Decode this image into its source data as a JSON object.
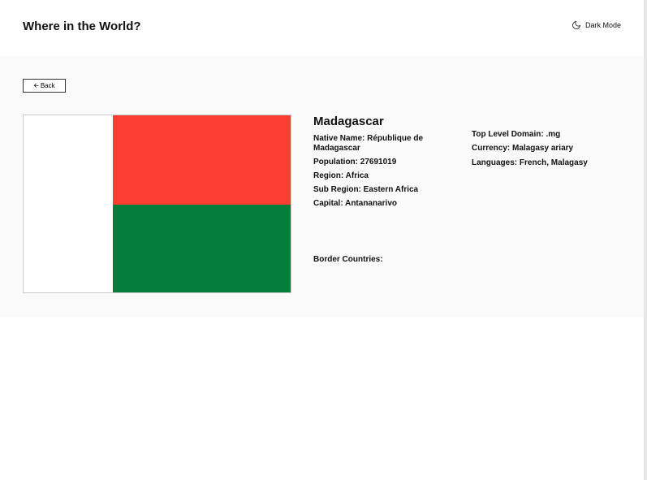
{
  "header": {
    "title": "Where in the World?",
    "theme_toggle_label": "Dark Mode",
    "theme_toggle_icon": "moon-icon"
  },
  "main": {
    "back_label": "Back",
    "back_icon": "arrow-left-icon",
    "flag": {
      "alt": "Flag of Madagascar",
      "colors": {
        "white": "#ffffff",
        "red": "#fc3d32",
        "green": "#007e3a"
      }
    },
    "country": {
      "name": "Madagascar",
      "native_name_label": "Native Name:",
      "native_name": "République de Madagascar",
      "population_label": "Population:",
      "population": "27691019",
      "region_label": "Region:",
      "region": "Africa",
      "subregion_label": "Sub Region:",
      "subregion": "Eastern Africa",
      "capital_label": "Capital:",
      "capital": "Antananarivo",
      "tld_label": "Top Level Domain:",
      "tld": ".mg",
      "currency_label": "Currency:",
      "currency": "Malagasy ariary",
      "languages_label": "Languages:",
      "languages": "French, Malagasy",
      "border_countries_label": "Border Countries:"
    }
  }
}
